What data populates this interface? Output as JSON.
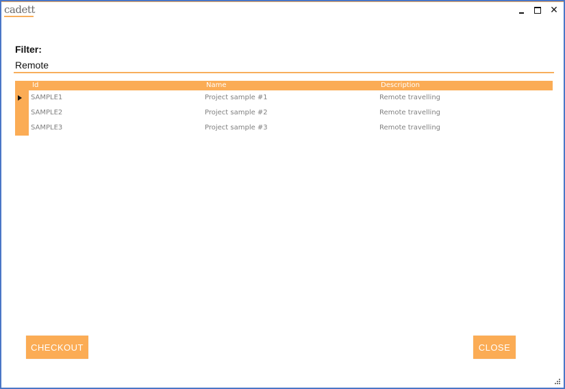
{
  "window": {
    "logo_text": "cadett",
    "controls": {
      "minimize": "minimize",
      "maximize": "maximize",
      "close": "✕"
    }
  },
  "filter": {
    "label": "Filter:",
    "value": "Remote",
    "placeholder": ""
  },
  "grid": {
    "columns": [
      "Id",
      "Name",
      "Description"
    ],
    "rows": [
      {
        "id": "SAMPLE1",
        "name": "Project sample #1",
        "description": "Remote travelling",
        "selected": true
      },
      {
        "id": "SAMPLE2",
        "name": "Project sample #2",
        "description": "Remote travelling",
        "selected": false
      },
      {
        "id": "SAMPLE3",
        "name": "Project sample #3",
        "description": "Remote travelling",
        "selected": false
      }
    ]
  },
  "buttons": {
    "checkout": "CHECKOUT",
    "close": "CLOSE"
  },
  "colors": {
    "accent": "#fbac55",
    "window_border": "#4a76c6"
  }
}
